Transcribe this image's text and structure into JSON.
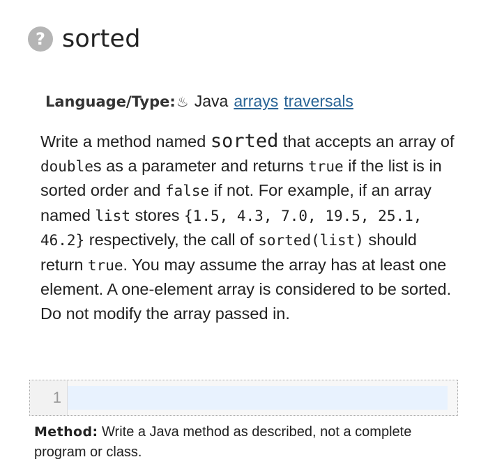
{
  "problem": {
    "help_icon_glyph": "?",
    "title": "sorted"
  },
  "meta": {
    "label": "Language/Type:",
    "java_icon_glyph": "♨",
    "language": "Java",
    "tags": [
      "arrays",
      "traversals"
    ]
  },
  "description": {
    "t1": "Write a method named ",
    "c1": "sorted",
    "t2": " that accepts an array of ",
    "c2": "double",
    "t3": "s as a parameter and returns ",
    "c3": "true",
    "t4": " if the list is in sorted order and ",
    "c4": "false",
    "t5": " if not. For example, if an array named ",
    "c5": "list",
    "t6": " stores ",
    "c6": "{1.5, 4.3, 7.0, 19.5, 25.1, 46.2}",
    "t7": " respectively, the call of ",
    "c7": "sorted(list)",
    "t8": " should return ",
    "c8": "true",
    "t9": ". You may assume the array has at least one element. A one-element array is considered to be sorted. Do not modify the array passed in."
  },
  "editor": {
    "line_numbers": [
      "1"
    ],
    "content": ""
  },
  "hint": {
    "label": "Method:",
    "text": " Write a Java method as described, not a complete program or class."
  },
  "colors": {
    "link": "#2a6496",
    "help_icon_bg": "#b5b5b5",
    "active_line": "#e8f2fe"
  }
}
